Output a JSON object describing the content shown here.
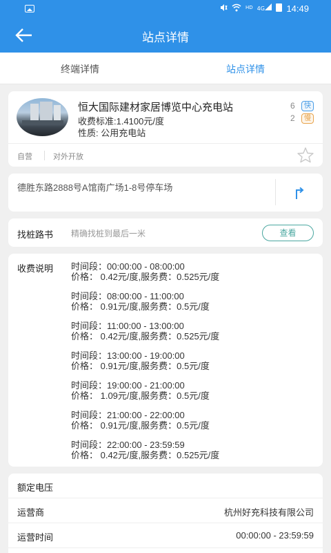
{
  "statusbar": {
    "time": "14:49",
    "icons": [
      "image-icon",
      "mute-icon",
      "wifi-icon",
      "hd-icon",
      "signal-icon",
      "battery-icon"
    ],
    "hd_label": "HD",
    "signal_label": "4G"
  },
  "header": {
    "title": "站点详情",
    "back_icon": "back-arrow-icon"
  },
  "tabs": [
    {
      "label": "终端详情",
      "active": false
    },
    {
      "label": "站点详情",
      "active": true
    }
  ],
  "station": {
    "name": "恒大国际建材家居博览中心充电站",
    "fee_standard": "收费标准:1.4100元/度",
    "nature": "性质: 公用充电站",
    "fast_count": "6",
    "fast_label": "快",
    "slow_count": "2",
    "slow_label": "慢",
    "tags": [
      "自营",
      "对外开放"
    ],
    "colors": {
      "fast": "#4a9de6",
      "slow": "#e8a34b"
    }
  },
  "address": {
    "text": "德胜东路2888号A馆南广场1-8号停车场"
  },
  "guide": {
    "label": "找桩路书",
    "desc": "精确找桩到最后一米",
    "button": "查看"
  },
  "fees": {
    "label": "收费说明",
    "periods": [
      {
        "time": "时间段：00:00:00 - 08:00:00",
        "price": "价格：  0.42元/度,服务费：0.525元/度"
      },
      {
        "time": "时间段：08:00:00 - 11:00:00",
        "price": "价格：  0.91元/度,服务费：0.5元/度"
      },
      {
        "time": "时间段：11:00:00 - 13:00:00",
        "price": "价格：  0.42元/度,服务费：0.525元/度"
      },
      {
        "time": "时间段：13:00:00 - 19:00:00",
        "price": "价格：  0.91元/度,服务费：0.5元/度"
      },
      {
        "time": "时间段：19:00:00 - 21:00:00",
        "price": "价格：  1.09元/度,服务费：0.5元/度"
      },
      {
        "time": "时间段：21:00:00 - 22:00:00",
        "price": "价格：  0.91元/度,服务费：0.5元/度"
      },
      {
        "time": "时间段：22:00:00 - 23:59:59",
        "price": "价格：  0.42元/度,服务费：0.525元/度"
      }
    ]
  },
  "info": [
    {
      "key": "额定电压",
      "value": ""
    },
    {
      "key": "运营商",
      "value": "杭州好充科技有限公司"
    },
    {
      "key": "运营时间",
      "value": "00:00:00 - 23:59:59"
    }
  ],
  "theme": {
    "primary": "#2f91e8",
    "accent": "#4aa7a0"
  }
}
